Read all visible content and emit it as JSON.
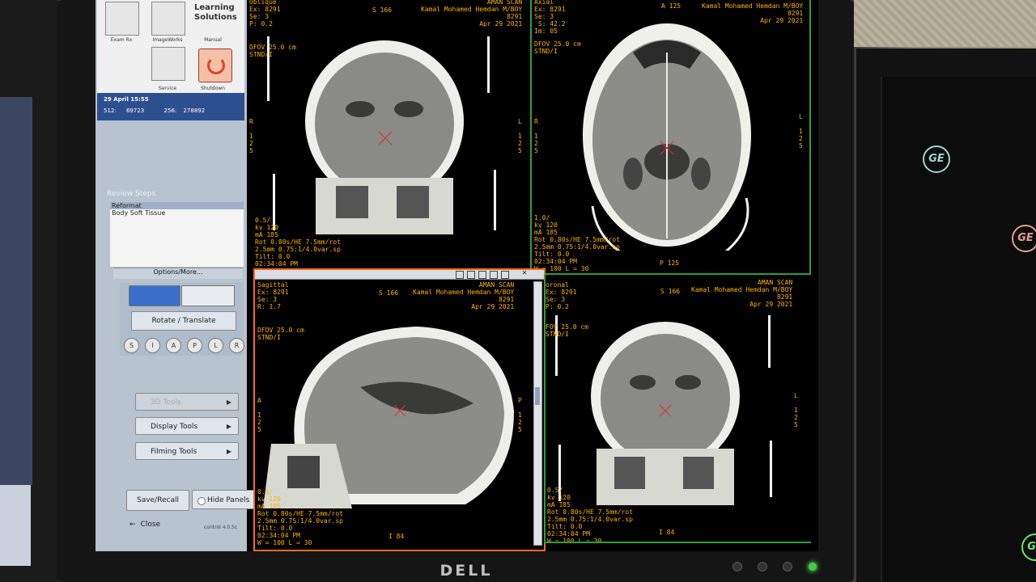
{
  "gui": {
    "icons": [
      {
        "label": "Exam Rx"
      },
      {
        "label": "ImageWorks"
      },
      {
        "label": "Manual"
      },
      {
        "label": "Service"
      },
      {
        "label": "Shutdown"
      }
    ],
    "learning_solutions": "Learning Solutions",
    "date_time": "29 April 15:55",
    "stat1_label": "512:",
    "stat1_value": "69723",
    "stat2_label": "256:",
    "stat2_value": "278892",
    "review_steps_title": "Review Steps",
    "review_steps": [
      "Reformat",
      "Body Soft Tissue"
    ],
    "options_more": "Options/More...",
    "rotate_translate": "Rotate / Translate",
    "directions": [
      "S",
      "I",
      "A",
      "P",
      "L",
      "R"
    ],
    "menu_3d_tools": "3D Tools",
    "menu_display_tools": "Display Tools",
    "menu_filming_tools": "Filming Tools",
    "save_recall": "Save/Recall",
    "hide_panels": "Hide Panels",
    "close": "Close",
    "build": "control 4.0.5c"
  },
  "viewports": {
    "coronal_top": {
      "header_left": "Oblique\nEx: 8291\nSe: 3\nP: 0.2",
      "header_center": "S 166",
      "header_right": "AMAN SCAN\nKamal Mohamed Hemdan M/BOY\n8291\nApr 29 2021",
      "dfov": "DFOV 25.0 cm\nSTND/I",
      "side_left": "R\n\n1\n2\n5",
      "side_right": "L\n\n1\n2\n5",
      "footer": "0.5/\nkv 120\nmA 185\nRot 0.80s/HE 7.5mm/rot\n2.5mm 0.75:1/4.0var.sp\nTilt: 0.0\n02:34:04 PM"
    },
    "axial_top": {
      "header_left": "Axial\nEx: 8291\nSe: 3\n S: 42.2\nIm: 05",
      "header_center": "A 125",
      "header_right": "Kamal Mohamed Hemdan M/BOY\n8291\nApr 29 2021",
      "dfov": "DFOV 25.0 cm\nSTND/I",
      "side_left": "R\n\n1\n2\n5",
      "side_right": "L\n\n1\n2\n5",
      "footer": "1.0/\nkv 120\nmA 185\nRot 0.80s/HE 7.5mm/rot\n2.5mm 0.75:1/4.0var.sp\nTilt: 0.0\n02:34:04 PM\nW = 100 L = 30",
      "footer_center": "P 125"
    },
    "sagittal": {
      "header_left": "Sagittal\nEx: 8291\nSe: 3\nR: 1.7",
      "header_center": "S 166",
      "header_right": "AMAN SCAN\nKamal Mohamed Hemdan M/BOY\n8291\nApr 29 2021",
      "dfov": "DFOV 25.0 cm\nSTND/I",
      "side_left": "A\n\n1\n2\n5",
      "side_right": "P\n\n1\n2\n5",
      "footer": "0.5/\nkv 120\nmA 185\nRot 0.80s/HE 7.5mm/rot\n2.5mm 0.75:1/4.0var.sp\nTilt: 0.0\n02:34:04 PM\nW = 100 L = 30",
      "footer_center": "I 84"
    },
    "coronal_bottom": {
      "header_left": "oronal\nEx: 8291\nSe: 3\nP: 0.2",
      "header_center": "S 166",
      "header_right": "AMAN SCAN\nKamal Mohamed Hemdan M/BOY\n8291\nApr 29 2021",
      "dfov": "FOV 25.0 cm\nSTND/I",
      "side_right": "L\n\n1\n2\n5",
      "footer": "0.5/\nkv 120\nmA 185\nRot 0.80s/HE 7.5mm/rot\n2.5mm 0.75:1/4.0var.sp\nTilt: 0.0\n02:34:04 PM\nW = 100 L = 30",
      "footer_center": "I 84"
    }
  },
  "hardware": {
    "brand": "DELL",
    "logo": "GE"
  }
}
